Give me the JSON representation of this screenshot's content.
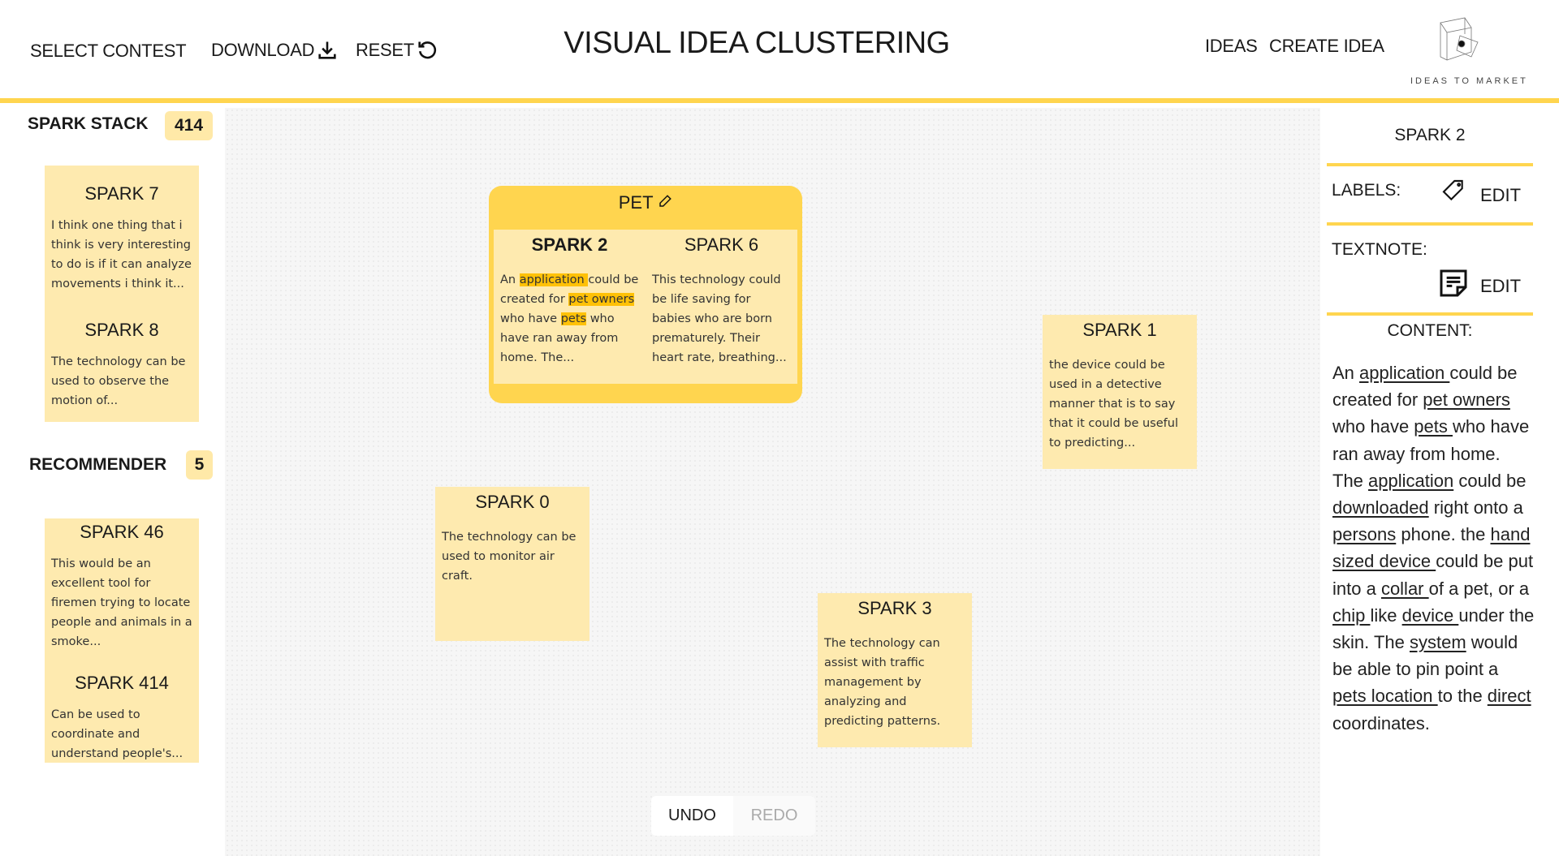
{
  "header": {
    "select_contest": "SELECT CONTEST",
    "download": "DOWNLOAD",
    "reset": "RESET",
    "title": "VISUAL IDEA CLUSTERING",
    "ideas": "IDEAS",
    "create_idea": "CREATE IDEA",
    "logo_text": "IDEAS TO MARKET"
  },
  "colors": {
    "accent": "#ffd54f",
    "card": "#feeaaf",
    "highlight": "#ffc107",
    "canvas": "#f6f6f6"
  },
  "spark_stack": {
    "title": "SPARK STACK",
    "count": "414",
    "cards": [
      {
        "title": "SPARK 7",
        "text": "I think one thing that i think is very interesting to do is if it can analyze movements i think it..."
      },
      {
        "title": "SPARK 8",
        "text": "The technology can be used to observe the motion of..."
      }
    ]
  },
  "recommender": {
    "title": "RECOMMENDER",
    "count": "5",
    "cards": [
      {
        "title": "SPARK 46",
        "text": "This would be an excellent tool for firemen trying to locate people and animals in a smoke..."
      },
      {
        "title": "SPARK 414",
        "text": "Can be used to coordinate and understand people's..."
      }
    ]
  },
  "cluster": {
    "label": "PET",
    "sparks": [
      {
        "title": "SPARK 2",
        "selected": true,
        "segments": [
          {
            "t": "An "
          },
          {
            "t": "application ",
            "h": true
          },
          {
            "t": "could be created for "
          },
          {
            "t": "pet owners ",
            "h": true
          },
          {
            "t": "who have "
          },
          {
            "t": "pets",
            "h": true
          },
          {
            "t": " who have ran away from home. The..."
          }
        ]
      },
      {
        "title": "SPARK 6",
        "text": "This technology could be life saving for babies who are born prematurely. Their heart rate, breathing..."
      }
    ]
  },
  "notes": [
    {
      "title": "SPARK 1",
      "text": "the device could be used in a detective manner that is to say that it could be useful to predicting..."
    },
    {
      "title": "SPARK 0",
      "text": "The technology can be used to monitor air craft."
    },
    {
      "title": "SPARK 3",
      "text": "The technology can assist with traffic management by analyzing and predicting patterns."
    }
  ],
  "toolbar": {
    "undo": "UNDO",
    "redo": "REDO"
  },
  "detail": {
    "title": "SPARK 2",
    "labels_label": "LABELS:",
    "labels_edit": "EDIT",
    "textnote_label": "TEXTNOTE:",
    "textnote_edit": "EDIT",
    "content_label": "CONTENT:",
    "content": [
      {
        "t": "An "
      },
      {
        "t": "application ",
        "u": true
      },
      {
        "t": "could be created for "
      },
      {
        "t": "pet owners",
        "u": true
      },
      {
        "t": " who have "
      },
      {
        "t": "pets ",
        "u": true
      },
      {
        "t": "who have ran away from home. The "
      },
      {
        "t": "application",
        "u": true
      },
      {
        "t": " could be "
      },
      {
        "t": "downloaded",
        "u": true
      },
      {
        "t": " right onto a "
      },
      {
        "t": "persons",
        "u": true
      },
      {
        "t": " phone. the "
      },
      {
        "t": "hand sized device ",
        "u": true
      },
      {
        "t": "could be put into a "
      },
      {
        "t": "collar ",
        "u": true
      },
      {
        "t": "of a pet, or a "
      },
      {
        "t": "chip ",
        "u": true
      },
      {
        "t": "like "
      },
      {
        "t": "device ",
        "u": true
      },
      {
        "t": "under the skin. The "
      },
      {
        "t": "system",
        "u": true
      },
      {
        "t": " would be able to pin point a "
      },
      {
        "t": "pets location ",
        "u": true
      },
      {
        "t": "to the "
      },
      {
        "t": "direct ",
        "u": true
      },
      {
        "t": "coordinates."
      }
    ]
  }
}
